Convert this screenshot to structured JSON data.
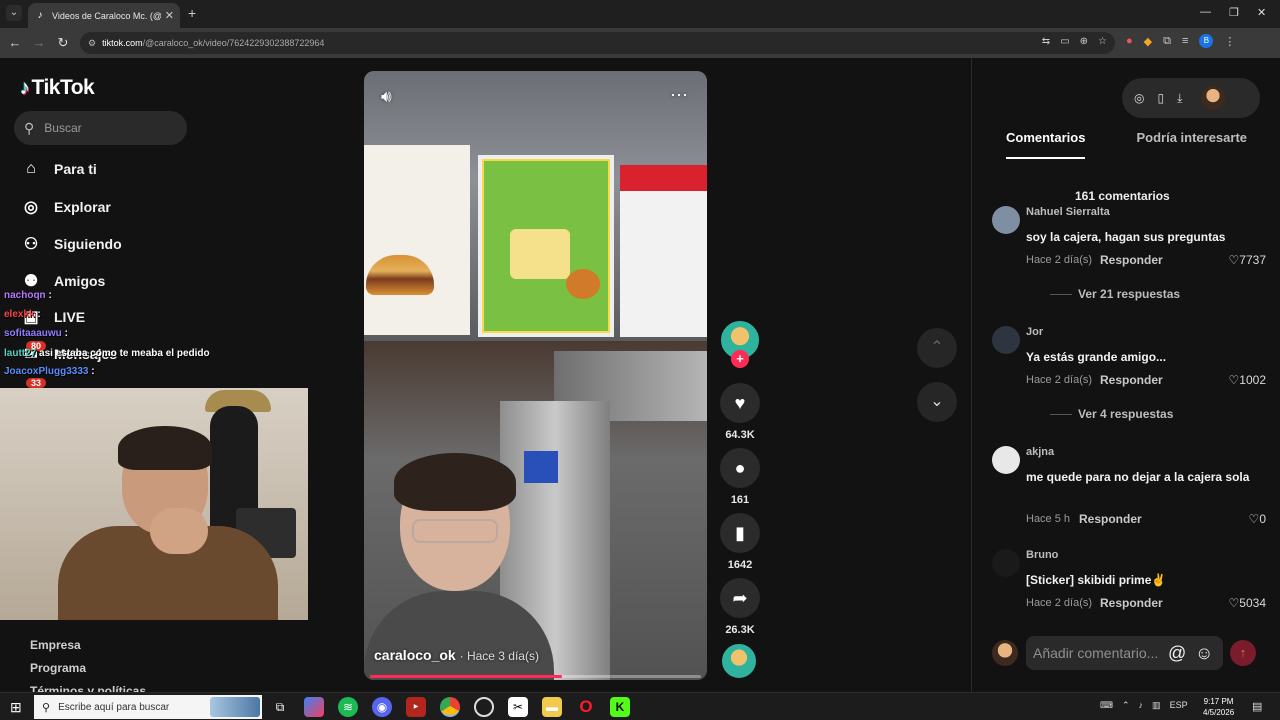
{
  "browser": {
    "tab_title": "Videos de Caraloco Mc. (@cara",
    "url_host": "tiktok.com",
    "url_path": "/@caraloco_ok/video/7624229302388722964",
    "profile_initial": "B"
  },
  "sidebar": {
    "logo": "TikTok",
    "search_placeholder": "Buscar",
    "items": [
      {
        "label": "Para ti"
      },
      {
        "label": "Explorar"
      },
      {
        "label": "Siguiendo"
      },
      {
        "label": "Amigos"
      },
      {
        "label": "LIVE"
      },
      {
        "label": "Mensajes"
      }
    ],
    "badges": [
      "80",
      "33"
    ],
    "footer_links": [
      "Empresa",
      "Programa",
      "Términos y políticas"
    ]
  },
  "stream_chat": [
    {
      "user": "nachoqn",
      "text": ":",
      "color": "#b678ff"
    },
    {
      "user": "elexkk",
      "text": ":",
      "color": "#ff4646"
    },
    {
      "user": "sofitaaauwu",
      "text": ":",
      "color": "#8f7dff"
    },
    {
      "user": "lautt27",
      "text": "asi estaba como te meaba el pedido",
      "color": "#4fd6c4"
    },
    {
      "user": "JoacoxPlugg3333",
      "text": ":",
      "color": "#5a8dff"
    }
  ],
  "video": {
    "author": "caraloco_ok",
    "time": "· Hace 3 día(s)",
    "progress": 0.58
  },
  "actions": {
    "likes": "64.3K",
    "comments": "161",
    "saves": "1642",
    "shares": "26.3K"
  },
  "right_panel": {
    "tab_comments": "Comentarios",
    "tab_interest": "Podría interesarte",
    "count_label": "161 comentarios",
    "reply_label": "Responder",
    "input_placeholder": "Añadir comentario...",
    "comments": [
      {
        "user": "Nahuel Sierralta",
        "text": "soy la cajera, hagan sus preguntas",
        "meta": "Hace 2 día(s)",
        "likes": "7737",
        "more": "Ver 21 respuestas"
      },
      {
        "user": "Jor",
        "text": "Ya estás grande amigo...",
        "meta": "Hace 2 día(s)",
        "likes": "1002",
        "more": "Ver 4 respuestas"
      },
      {
        "user": "akjna",
        "text": "me quede para no dejar a la cajera sola",
        "meta": "Hace 5 h",
        "likes": "0"
      },
      {
        "user": "Bruno",
        "text": "[Sticker] skibidi prime✌",
        "meta": "Hace 2 día(s)",
        "likes": "5034"
      }
    ]
  },
  "taskbar": {
    "search_placeholder": "Escribe aquí para buscar",
    "lang": "ESP",
    "time": "9:17 PM",
    "date": "4/5/2026"
  }
}
